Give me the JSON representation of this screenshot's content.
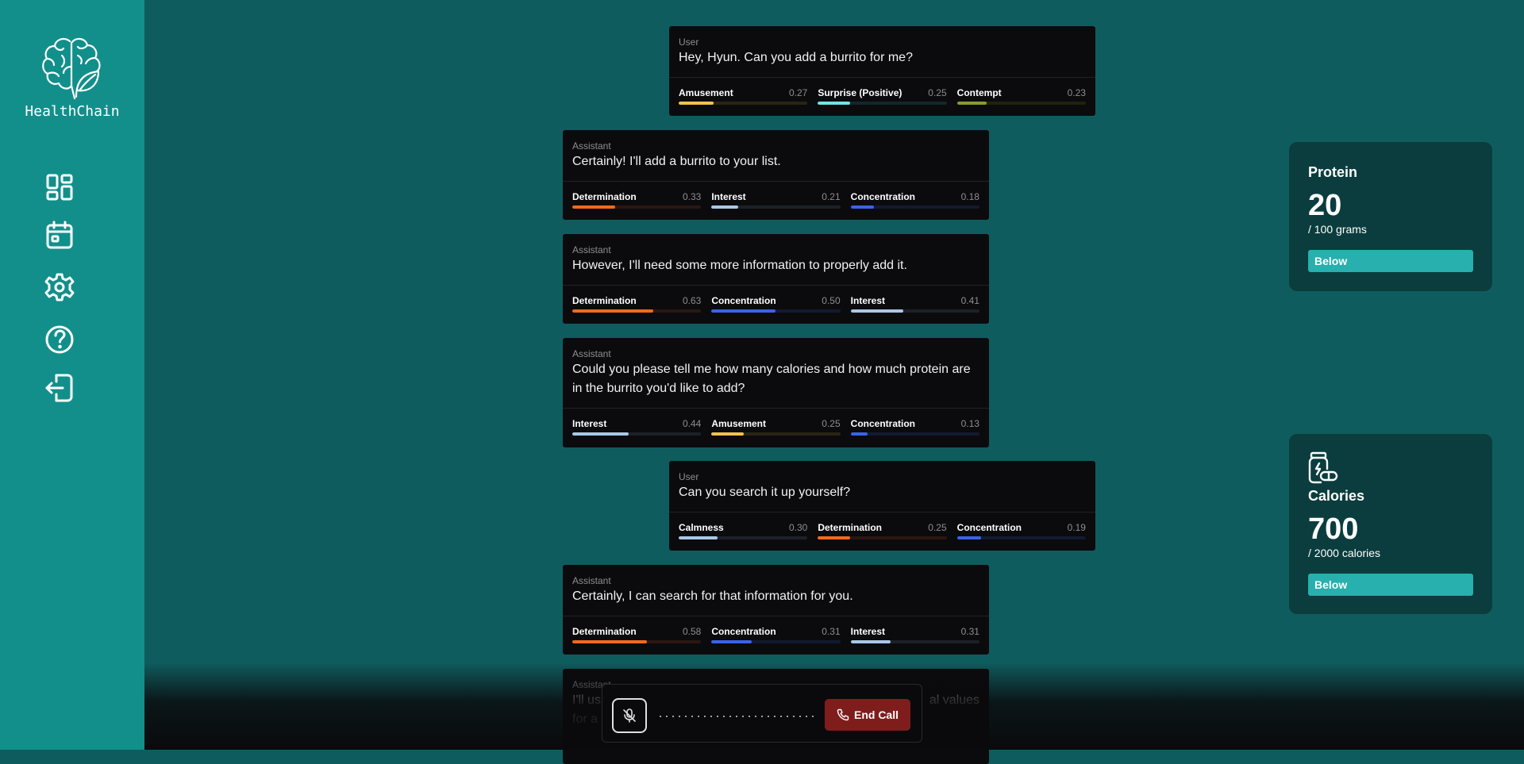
{
  "app": {
    "brand": "HealthChain"
  },
  "nav": [
    {
      "name": "dashboard-icon"
    },
    {
      "name": "calendar-icon"
    },
    {
      "name": "gear-icon"
    },
    {
      "name": "help-icon"
    },
    {
      "name": "logout-icon"
    }
  ],
  "messages": [
    {
      "role": "User",
      "text": "Hey, Hyun. Can you add a burrito for me?",
      "emotions": [
        {
          "name": "Amusement",
          "value": "0.27",
          "score": 0.27,
          "color": "#f2c14e",
          "track": "#2a2414"
        },
        {
          "name": "Surprise (Positive)",
          "value": "0.25",
          "score": 0.25,
          "color": "#6fe3e8",
          "track": "#12282a"
        },
        {
          "name": "Contempt",
          "value": "0.23",
          "score": 0.23,
          "color": "#8a9a2e",
          "track": "#20220f"
        }
      ]
    },
    {
      "role": "Assistant",
      "text": "Certainly! I'll add a burrito to your list.",
      "emotions": [
        {
          "name": "Determination",
          "value": "0.33",
          "score": 0.33,
          "color": "#f26a1b",
          "track": "#2a1710"
        },
        {
          "name": "Interest",
          "value": "0.21",
          "score": 0.21,
          "color": "#a9c8e8",
          "track": "#1c2128"
        },
        {
          "name": "Concentration",
          "value": "0.18",
          "score": 0.18,
          "color": "#3a63e8",
          "track": "#121a30"
        }
      ]
    },
    {
      "role": "Assistant",
      "text": "However, I'll need some more information to properly add it.",
      "emotions": [
        {
          "name": "Determination",
          "value": "0.63",
          "score": 0.63,
          "color": "#f26a1b",
          "track": "#2a1710"
        },
        {
          "name": "Concentration",
          "value": "0.50",
          "score": 0.5,
          "color": "#3a63e8",
          "track": "#121a30"
        },
        {
          "name": "Interest",
          "value": "0.41",
          "score": 0.41,
          "color": "#a9c8e8",
          "track": "#1c2128"
        }
      ]
    },
    {
      "role": "Assistant",
      "text": "Could you please tell me how many calories and how much protein are in the burrito you'd like to add?",
      "emotions": [
        {
          "name": "Interest",
          "value": "0.44",
          "score": 0.44,
          "color": "#a9c8e8",
          "track": "#1c2128"
        },
        {
          "name": "Amusement",
          "value": "0.25",
          "score": 0.25,
          "color": "#f2c14e",
          "track": "#2a2414"
        },
        {
          "name": "Concentration",
          "value": "0.13",
          "score": 0.13,
          "color": "#3a63e8",
          "track": "#121a30"
        }
      ]
    },
    {
      "role": "User",
      "text": "Can you search it up yourself?",
      "emotions": [
        {
          "name": "Calmness",
          "value": "0.30",
          "score": 0.3,
          "color": "#a9c8e8",
          "track": "#1c2128"
        },
        {
          "name": "Determination",
          "value": "0.25",
          "score": 0.25,
          "color": "#f26a1b",
          "track": "#2a1710"
        },
        {
          "name": "Concentration",
          "value": "0.19",
          "score": 0.19,
          "color": "#3a63e8",
          "track": "#121a30"
        }
      ]
    },
    {
      "role": "Assistant",
      "text": "Certainly, I can search for that information for you.",
      "emotions": [
        {
          "name": "Determination",
          "value": "0.58",
          "score": 0.58,
          "color": "#f26a1b",
          "track": "#2a1710"
        },
        {
          "name": "Concentration",
          "value": "0.31",
          "score": 0.31,
          "color": "#3a63e8",
          "track": "#121a30"
        },
        {
          "name": "Interest",
          "value": "0.31",
          "score": 0.31,
          "color": "#a9c8e8",
          "track": "#1c2128"
        }
      ]
    },
    {
      "role": "Assistant",
      "text": "I'll us",
      "text2": "al values",
      "text3": "for a"
    }
  ],
  "cards": {
    "protein": {
      "label": "Protein",
      "value": "20",
      "sub": "/ 100 grams",
      "status": "Below"
    },
    "calories": {
      "label": "Calories",
      "value": "700",
      "sub": "/ 2000 calories",
      "status": "Below"
    }
  },
  "call": {
    "end_label": "End Call"
  },
  "colors": {
    "sidebar": "#128f8b",
    "main": "#0f5c5e",
    "card": "#0b3d3e",
    "badge": "#27b0ad",
    "end": "#7f1d1d"
  }
}
